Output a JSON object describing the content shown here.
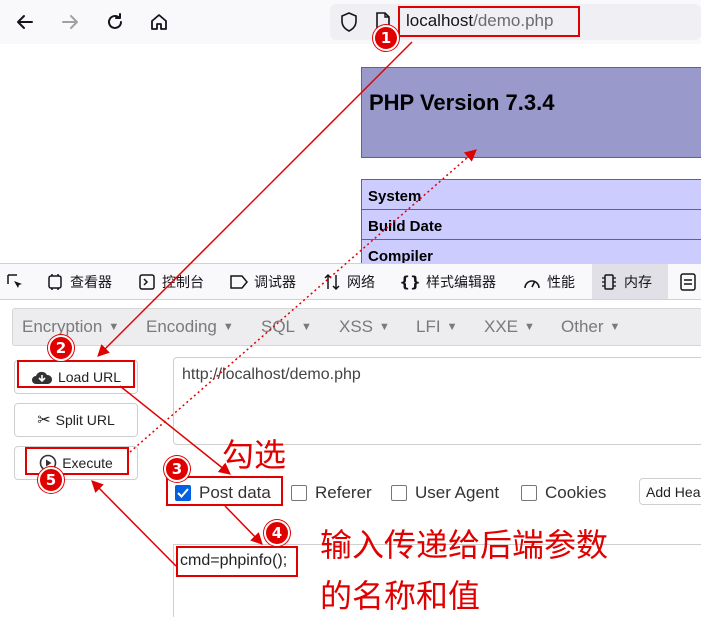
{
  "browser": {
    "url_host": "localhost",
    "url_path": "/demo.php"
  },
  "php_page": {
    "title": "PHP Version 7.3.4",
    "rows": [
      "System",
      "Build Date",
      "Compiler"
    ]
  },
  "devtools": {
    "tabs": [
      {
        "label": "查看器",
        "icon": "inspector-icon"
      },
      {
        "label": "控制台",
        "icon": "console-icon"
      },
      {
        "label": "调试器",
        "icon": "debugger-icon"
      },
      {
        "label": "网络",
        "icon": "network-icon"
      },
      {
        "label": "样式编辑器",
        "icon": "style-editor-icon"
      },
      {
        "label": "性能",
        "icon": "performance-icon"
      },
      {
        "label": "内存",
        "icon": "memory-icon"
      }
    ]
  },
  "hackbar": {
    "menu": [
      "Encryption",
      "Encoding",
      "SQL",
      "XSS",
      "LFI",
      "XXE",
      "Other"
    ],
    "load_url": "Load URL",
    "split_url": "Split URL",
    "execute": "Execute",
    "url_value": "http://localhost/demo.php",
    "options": {
      "post_data": "Post data",
      "referer": "Referer",
      "user_agent": "User Agent",
      "cookies": "Cookies"
    },
    "add_header": "Add Hea",
    "post_value": "cmd=phpinfo();"
  },
  "annotations": {
    "badges": [
      "1",
      "2",
      "3",
      "4",
      "5"
    ],
    "note_check": "勾选",
    "note_input_line1": "输入传递给后端参数",
    "note_input_line2": "的名称和值",
    "accent_color": "#e00000"
  }
}
